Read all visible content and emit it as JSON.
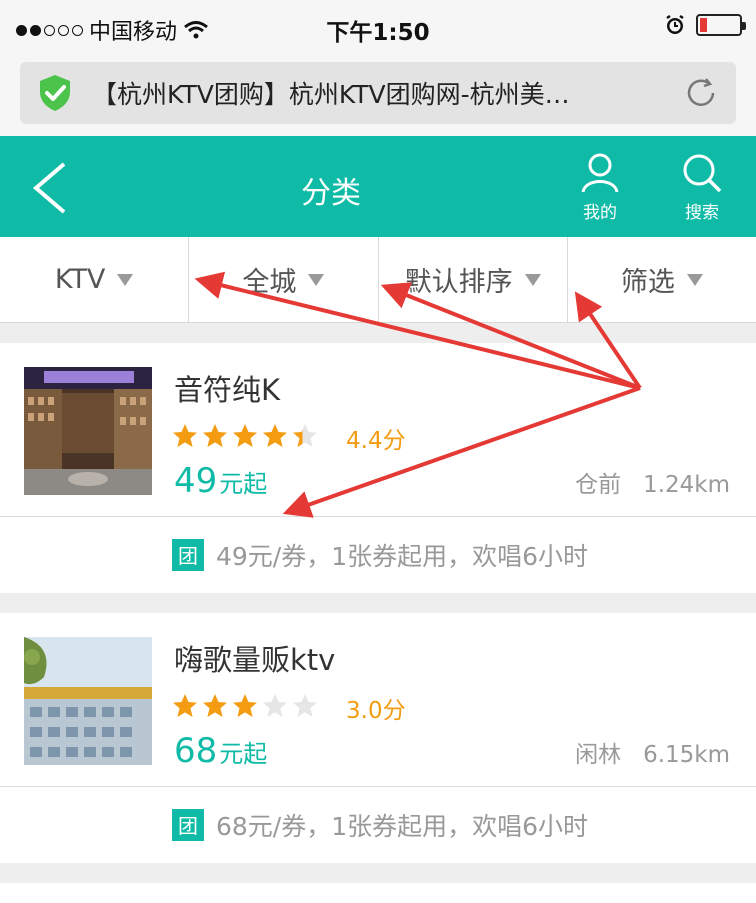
{
  "status_bar": {
    "carrier": "中国移动",
    "time": "下午1:50"
  },
  "browser": {
    "url_title": "【杭州KTV团购】杭州KTV团购网-杭州美…"
  },
  "header": {
    "title": "分类",
    "my_label": "我的",
    "search_label": "搜索"
  },
  "filters": [
    {
      "label": "KTV"
    },
    {
      "label": "全城"
    },
    {
      "label": "默认排序"
    },
    {
      "label": "筛选"
    }
  ],
  "listings": [
    {
      "name": "音符纯K",
      "rating": 4.4,
      "score_text": "4.4分",
      "price": "49",
      "price_unit": "元起",
      "district": "仓前",
      "distance": "1.24km",
      "deal": "49元/券，1张券起用，欢唱6小时",
      "deal_badge": "团"
    },
    {
      "name": "嗨歌量贩ktv",
      "rating": 3.0,
      "score_text": "3.0分",
      "price": "68",
      "price_unit": "元起",
      "district": "闲林",
      "distance": "6.15km",
      "deal": "68元/券，1张券起用，欢唱6小时",
      "deal_badge": "团"
    }
  ],
  "colors": {
    "accent": "#0fbba6",
    "star": "#f39c12",
    "annotation_arrow": "#e53935"
  }
}
